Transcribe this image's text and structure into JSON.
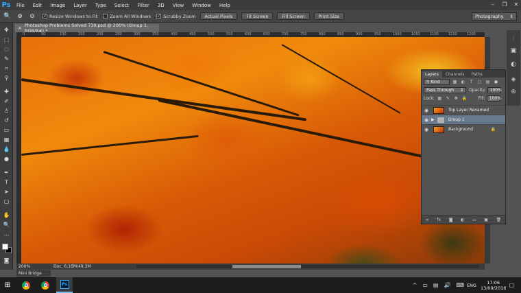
{
  "menu": {
    "logo": "Ps",
    "items": [
      "File",
      "Edit",
      "Image",
      "Layer",
      "Type",
      "Select",
      "Filter",
      "3D",
      "View",
      "Window",
      "Help"
    ]
  },
  "window_controls": {
    "minimize": "–",
    "restore": "❐",
    "close": "✕"
  },
  "options": {
    "resize_windows": "Resize Windows to Fit",
    "zoom_all": "Zoom All Windows",
    "scrubby_zoom": "Scrubby Zoom",
    "actual_pixels": "Actual Pixels",
    "fit_screen": "Fit Screen",
    "fill_screen": "Fill Screen",
    "print_size": "Print Size",
    "workspace": "Photography"
  },
  "document": {
    "tab_title": "Photoshop Problems Solved 730.psd @ 200% (Group 1, RGB/8#) *"
  },
  "ruler": {
    "ticks": [
      "0",
      "50",
      "100",
      "150",
      "200",
      "250",
      "300",
      "350",
      "400",
      "450",
      "500",
      "550",
      "600",
      "650",
      "700",
      "750",
      "800",
      "850",
      "900",
      "950",
      "1000",
      "1050",
      "1100",
      "1150",
      "1200"
    ]
  },
  "status": {
    "zoom": "200%",
    "doc": "Doc: 6.16M/49.3M"
  },
  "mini_bridge": "Mini Bridge",
  "layers_panel": {
    "tabs": [
      "Layers",
      "Channels",
      "Paths"
    ],
    "filter_kind": "Kind",
    "blend_mode": "Pass Through",
    "opacity_label": "Opacity:",
    "opacity_value": "100%",
    "lock_label": "Lock:",
    "fill_label": "Fill:",
    "fill_value": "100%",
    "layers": [
      {
        "name": "Top Layer Renamed",
        "type": "pixel",
        "selected": false
      },
      {
        "name": "Group 1",
        "type": "group",
        "selected": true
      },
      {
        "name": "Background",
        "type": "pixel",
        "selected": false,
        "locked": true
      }
    ]
  },
  "taskbar": {
    "language": "ENG",
    "time": "17:06",
    "date": "13/09/2016"
  }
}
